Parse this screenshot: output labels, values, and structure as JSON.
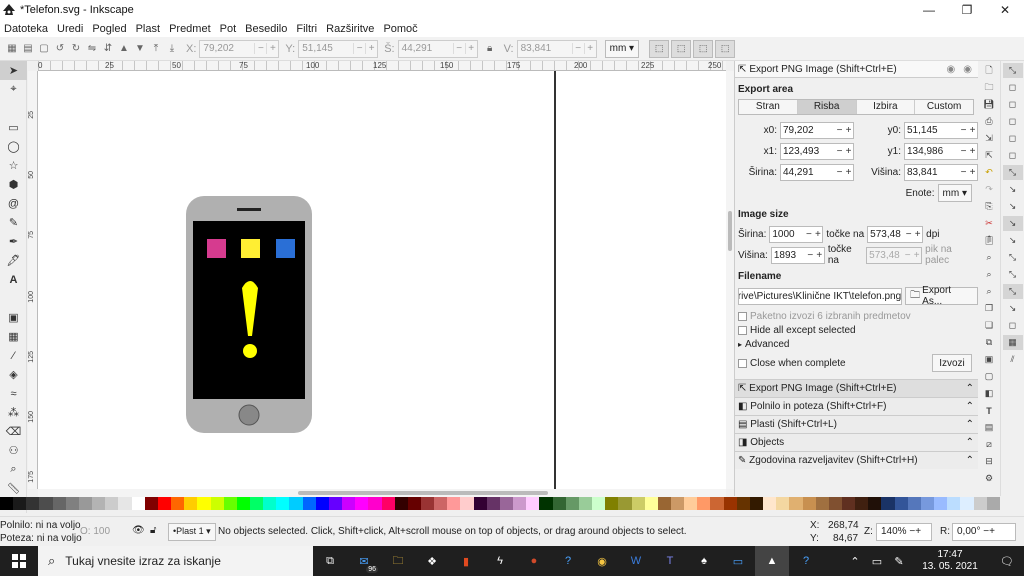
{
  "window": {
    "title": "*Telefon.svg - Inkscape",
    "minimize": "—",
    "maximize": "❐",
    "close": "✕"
  },
  "menu": [
    "Datoteka",
    "Uredi",
    "Pogled",
    "Plast",
    "Predmet",
    "Pot",
    "Besedilo",
    "Filtri",
    "Razširitve",
    "Pomoč"
  ],
  "toolbar": {
    "x_label": "X:",
    "x_value": "79,202",
    "y_label": "Y:",
    "y_value": "51,145",
    "w_label": "Š:",
    "w_value": "44,291",
    "h_label": "V:",
    "h_value": "83,841",
    "unit": "mm"
  },
  "ruler_top_labels": [
    "0",
    "25",
    "50",
    "75",
    "100",
    "125",
    "150",
    "175",
    "200",
    "225",
    "250"
  ],
  "ruler_left_labels": [
    "25",
    "50",
    "75",
    "100",
    "125",
    "150",
    "175"
  ],
  "dock": {
    "header": "Export PNG Image (Shift+Ctrl+E)",
    "export_area_title": "Export area",
    "area_tabs": [
      "Stran",
      "Risba",
      "Izbira",
      "Custom"
    ],
    "area_selected": "Risba",
    "x0_label": "x0:",
    "x0": "79,202",
    "y0_label": "y0:",
    "y0": "51,145",
    "x1_label": "x1:",
    "x1": "123,493",
    "y1_label": "y1:",
    "y1": "134,986",
    "sirina_label": "Širina:",
    "sirina": "44,291",
    "visina_label": "Višina:",
    "visina": "83,841",
    "enote_label": "Enote:",
    "enote": "mm",
    "image_size_title": "Image size",
    "img_w_label": "Širina:",
    "img_w": "1000",
    "img_h_label": "Višina:",
    "img_h": "1893",
    "tocke_na": "točke na",
    "dpi_value": "573,48",
    "dpi_unit": "dpi",
    "dpi_value2": "573,48",
    "pik_na_palec": "pik na palec",
    "filename_title": "Filename",
    "filename": "Drive\\Pictures\\Klinične IKT\\telefon.png",
    "export_as": "Export As...",
    "batch": "Paketno izvozi 6 izbranih predmetov",
    "hide_all": "Hide all except selected",
    "advanced": "Advanced",
    "close_when_complete": "Close when complete",
    "izvozi": "Izvozi",
    "panels": [
      "Export PNG Image (Shift+Ctrl+E)",
      "Polnilo in poteza  (Shift+Ctrl+F)",
      "Plasti  (Shift+Ctrl+L)",
      "Objects",
      "Zgodovina razveljavitev  (Shift+Ctrl+H)"
    ]
  },
  "status": {
    "fill_label": "Polnilo: ni na voljo",
    "stroke_label": "Poteza: ni na voljo",
    "opacity_label": "O:",
    "opacity_value": "100",
    "layer": "•Plast 1",
    "message": "No objects selected. Click, Shift+click, Alt+scroll mouse on top of objects, or drag around objects to select.",
    "x_label": "X:",
    "x": "268,74",
    "y_label": "Y:",
    "y": "84,67",
    "zoom_label": "Z:",
    "zoom": "140%",
    "rot_label": "R:",
    "rotation": "0,00°"
  },
  "phone": {
    "body_color": "#b0b0b0",
    "screen_color": "#000000",
    "app_colors": [
      "#d63b8f",
      "#ffee33",
      "#2a6fd6"
    ],
    "exclamation_color": "#ffff00",
    "home_button_color": "#888888"
  },
  "palette": [
    "#000000",
    "#1a1a1a",
    "#333333",
    "#4d4d4d",
    "#666666",
    "#808080",
    "#999999",
    "#b3b3b3",
    "#cccccc",
    "#e6e6e6",
    "#ffffff",
    "#800000",
    "#ff0000",
    "#ff6600",
    "#ffcc00",
    "#ffff00",
    "#ccff00",
    "#66ff00",
    "#00ff00",
    "#00ff66",
    "#00ffcc",
    "#00ffff",
    "#00ccff",
    "#0066ff",
    "#0000ff",
    "#6600ff",
    "#cc00ff",
    "#ff00ff",
    "#ff00cc",
    "#ff0066",
    "#330000",
    "#660000",
    "#993333",
    "#cc6666",
    "#ff9999",
    "#ffcccc",
    "#330033",
    "#663366",
    "#996699",
    "#cc99cc",
    "#ffccff",
    "#003300",
    "#336633",
    "#669966",
    "#99cc99",
    "#ccffcc",
    "#808000",
    "#999933",
    "#cccc66",
    "#ffff99",
    "#996633",
    "#cc9966",
    "#ffcc99",
    "#ff9966",
    "#cc6633",
    "#993300",
    "#663300",
    "#331a00",
    "#ffe6cc",
    "#f4d7a1",
    "#e0b070",
    "#c89050",
    "#a07040",
    "#805030",
    "#603020",
    "#402010",
    "#201008",
    "#1a3366",
    "#335599",
    "#5577bb",
    "#7799dd",
    "#99bbff",
    "#bbddff",
    "#ddeeff",
    "#cccccc",
    "#aaaaaa"
  ],
  "taskbar": {
    "search_placeholder": "Tukaj vnesite izraz za iskanje",
    "mail_badge": "96",
    "time": "17:47",
    "date": "13. 05. 2021"
  }
}
